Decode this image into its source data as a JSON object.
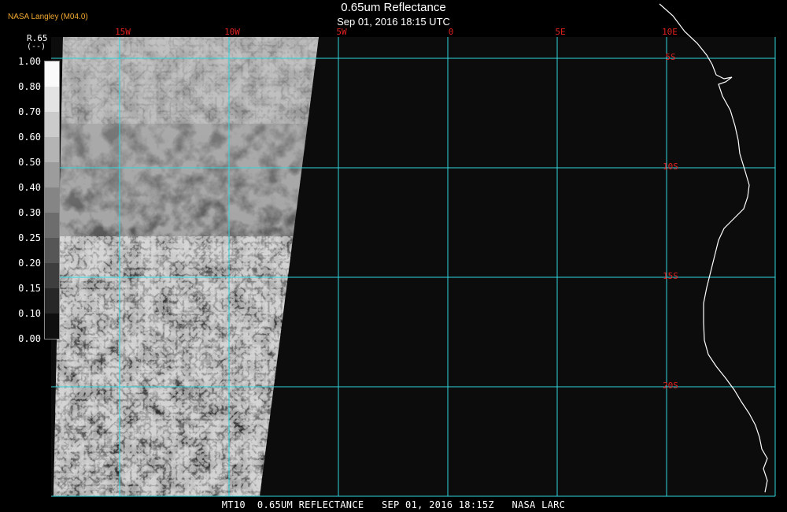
{
  "header": {
    "credit": "NASA Langley (M04.0)",
    "title": "0.65um Reflectance",
    "datetime": "Sep 01, 2016 18:15 UTC"
  },
  "footer": {
    "text": "MT10  0.65UM REFLECTANCE   SEP 01, 2016 18:15Z   NASA LARC"
  },
  "legend": {
    "title": "R.65",
    "unit": "(--)",
    "tick_labels": [
      "1.00",
      "0.80",
      "0.70",
      "0.60",
      "0.50",
      "0.40",
      "0.30",
      "0.25",
      "0.20",
      "0.15",
      "0.10",
      "0.00"
    ]
  },
  "map": {
    "longitude_labels": [
      "15W",
      "10W",
      "5W",
      "0",
      "5E",
      "10E"
    ],
    "latitude_labels": [
      "5S",
      "10S",
      "15S",
      "20S"
    ],
    "colors": {
      "grid": "#30d8e0",
      "label": "#e02020",
      "coast": "#ffffff",
      "background": "#0c0c0c"
    }
  }
}
